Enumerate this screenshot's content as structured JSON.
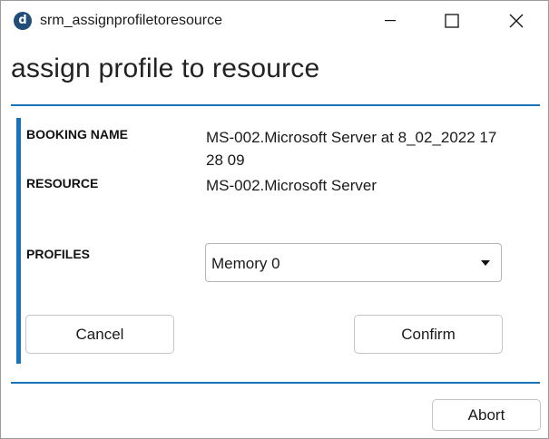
{
  "window": {
    "app_icon_letter": "d",
    "title": "srm_assignprofiletoresource",
    "controls": {
      "minimize_icon": "minimize-icon",
      "maximize_icon": "maximize-icon",
      "close_icon": "close-icon"
    }
  },
  "page": {
    "heading": "assign profile to resource"
  },
  "form": {
    "booking_name_label": "BOOKING NAME",
    "booking_name_value": "MS-002.Microsoft Server at 8_02_2022 17 28 09",
    "resource_label": "RESOURCE",
    "resource_value": "MS-002.Microsoft Server",
    "profiles_label": "PROFILES",
    "profiles_selected": "Memory 0"
  },
  "actions": {
    "cancel_label": "Cancel",
    "confirm_label": "Confirm",
    "abort_label": "Abort"
  },
  "colors": {
    "accent": "#1a73b8",
    "app_icon": "#1f4e79"
  }
}
